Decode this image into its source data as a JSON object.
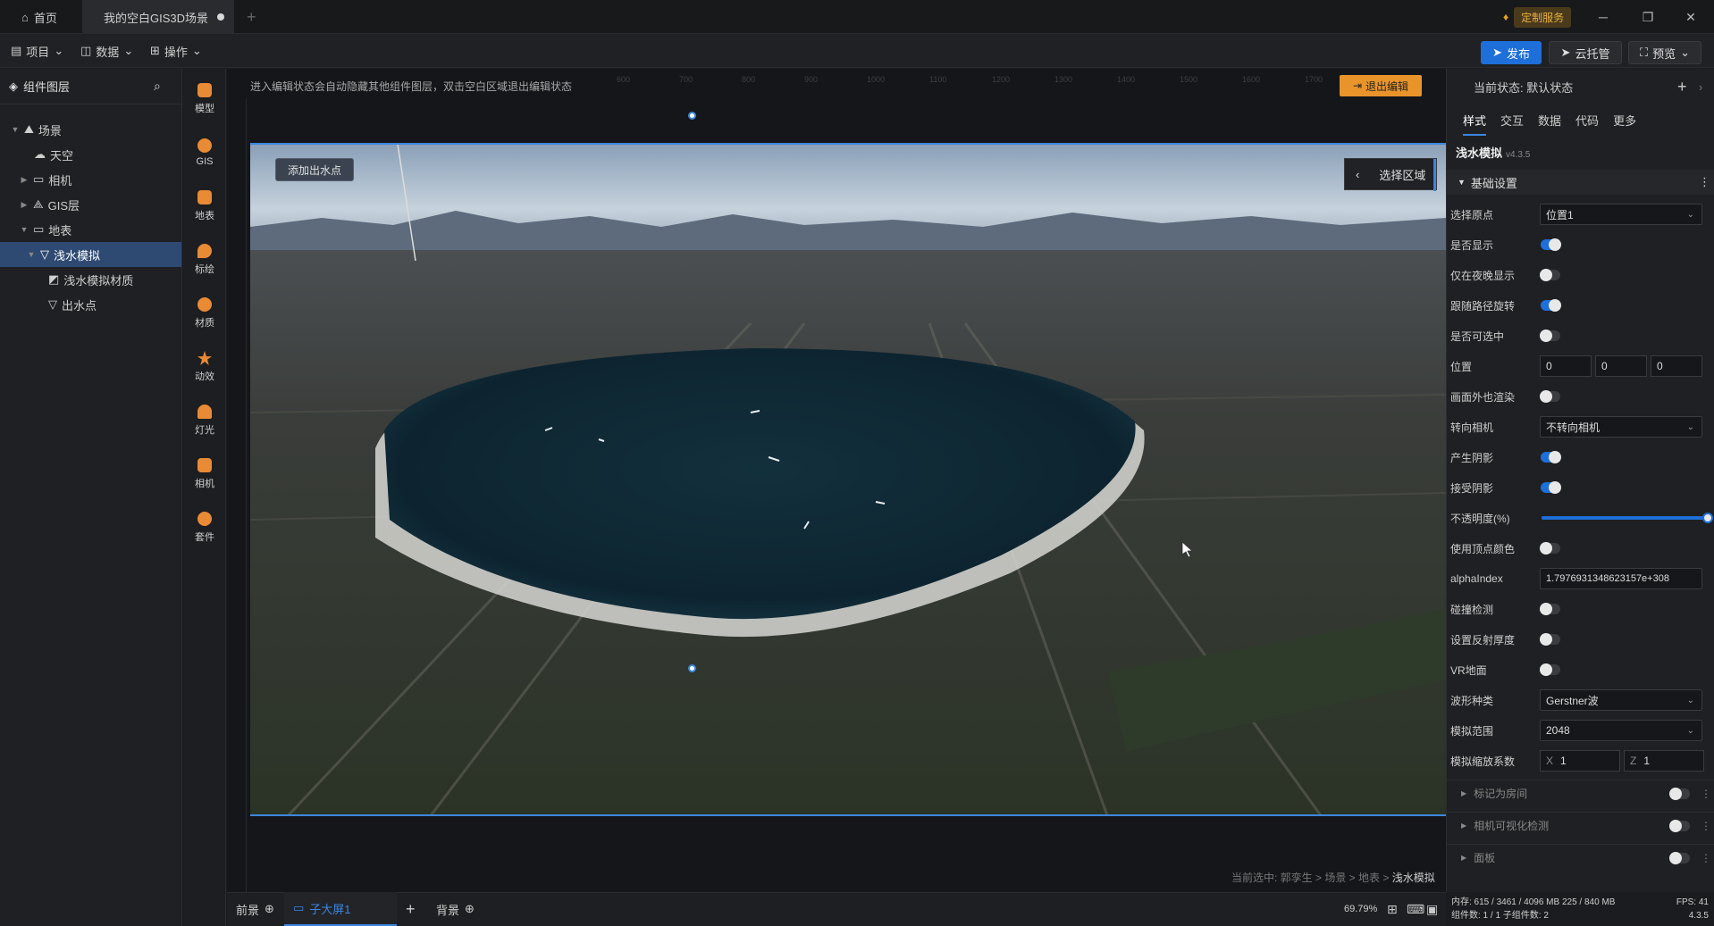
{
  "titlebar": {
    "home_tab": "首页",
    "scene_tab": "我的空白GIS3D场景",
    "custom_service": "定制服务"
  },
  "menubar": {
    "project": "项目",
    "data": "数据",
    "operate": "操作",
    "publish": "发布",
    "cloud": "云托管",
    "preview": "预览"
  },
  "layers": {
    "title": "组件图层",
    "items": [
      {
        "label": "场景"
      },
      {
        "label": "天空"
      },
      {
        "label": "相机"
      },
      {
        "label": "GIS层"
      },
      {
        "label": "地表"
      },
      {
        "label": "浅水模拟"
      },
      {
        "label": "浅水模拟材质"
      },
      {
        "label": "出水点"
      }
    ]
  },
  "tools": [
    "模型",
    "GIS",
    "地表",
    "标绘",
    "材质",
    "动效",
    "灯光",
    "相机",
    "套件"
  ],
  "canvas": {
    "hint": "进入编辑状态会自动隐藏其他组件图层，双击空白区域退出编辑状态",
    "exit_edit": "退出编辑",
    "add_outlet": "添加出水点",
    "select_region": "选择区域",
    "crumbs_prefix": "当前选中: 郭孪生 > 场景 > 地表 > ",
    "crumbs_current": "浅水模拟",
    "ruler_ticks": [
      "600",
      "700",
      "800",
      "900",
      "1000",
      "1100",
      "1200",
      "1300",
      "1400",
      "1500",
      "1600",
      "1700"
    ]
  },
  "bottombar": {
    "front": "前景",
    "sub_screen": "子大屏1",
    "back": "背景",
    "zoom": "69.79%"
  },
  "rpanel": {
    "state": "当前状态:  默认状态",
    "tabs": [
      "样式",
      "交互",
      "数据",
      "代码",
      "更多"
    ],
    "component_name": "浅水模拟",
    "version": "v4.3.5",
    "section": "基础设置",
    "origin_label": "选择原点",
    "origin_value": "位置1",
    "show_label": "是否显示",
    "night_label": "仅在夜晚显示",
    "follow_label": "跟随路径旋转",
    "selectable_label": "是否可选中",
    "pos_label": "位置",
    "pos_x": "0",
    "pos_y": "0",
    "pos_z": "0",
    "offscreen_label": "画面外也渲染",
    "facecam_label": "转向相机",
    "facecam_value": "不转向相机",
    "cast_label": "产生阴影",
    "recv_label": "接受阴影",
    "opacity_label": "不透明度(%)",
    "opacity_value": 100,
    "vcolor_label": "使用顶点颜色",
    "alpha_label": "alphaIndex",
    "alpha_value": "1.7976931348623157e+308",
    "collide_label": "碰撞检测",
    "reflect_label": "设置反射厚度",
    "vr_label": "VR地面",
    "wave_label": "波形种类",
    "wave_value": "Gerstner波",
    "range_label": "模拟范围",
    "range_value": "2048",
    "scale_label": "模拟缩放系数",
    "scale_x_tag": "X",
    "scale_x": "1",
    "scale_z_tag": "Z",
    "scale_z": "1",
    "coll_room": "标记为房间",
    "coll_camvis": "相机可视化检测",
    "coll_panel": "面板"
  },
  "status": {
    "mem": "内存:  615 / 3461 / 4096 MB  225 / 840 MB",
    "fps": "FPS:  41",
    "count": "组件数: 1 / 1    子组件数: 2",
    "ver": "4.3.5"
  }
}
